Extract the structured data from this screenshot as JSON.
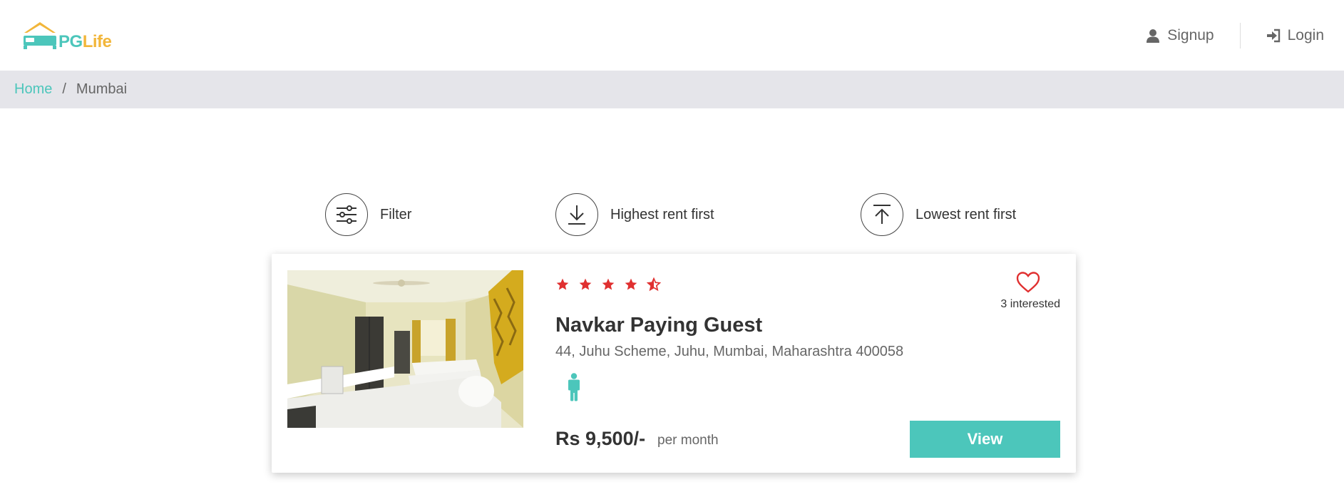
{
  "brand": {
    "name_part1": "PG",
    "name_part2": "Life"
  },
  "nav": {
    "signup_label": "Signup",
    "login_label": "Login"
  },
  "breadcrumb": {
    "home": "Home",
    "separator": "/",
    "current": "Mumbai"
  },
  "toolbar": {
    "filter_label": "Filter",
    "highest_label": "Highest rent first",
    "lowest_label": "Lowest rent first"
  },
  "property": {
    "rating": 4.5,
    "name": "Navkar Paying Guest",
    "address": "44, Juhu Scheme, Juhu, Mumbai, Maharashtra 400058",
    "gender_icon": "male-icon",
    "price": "Rs 9,500/-",
    "price_suffix": "per month",
    "interested": "3 interested",
    "view_label": "View"
  },
  "colors": {
    "accent": "#4cc6bb",
    "logo_yellow": "#f2b63a",
    "star_red": "#e03030",
    "breadcrumb_bg": "#e5e5ea"
  }
}
